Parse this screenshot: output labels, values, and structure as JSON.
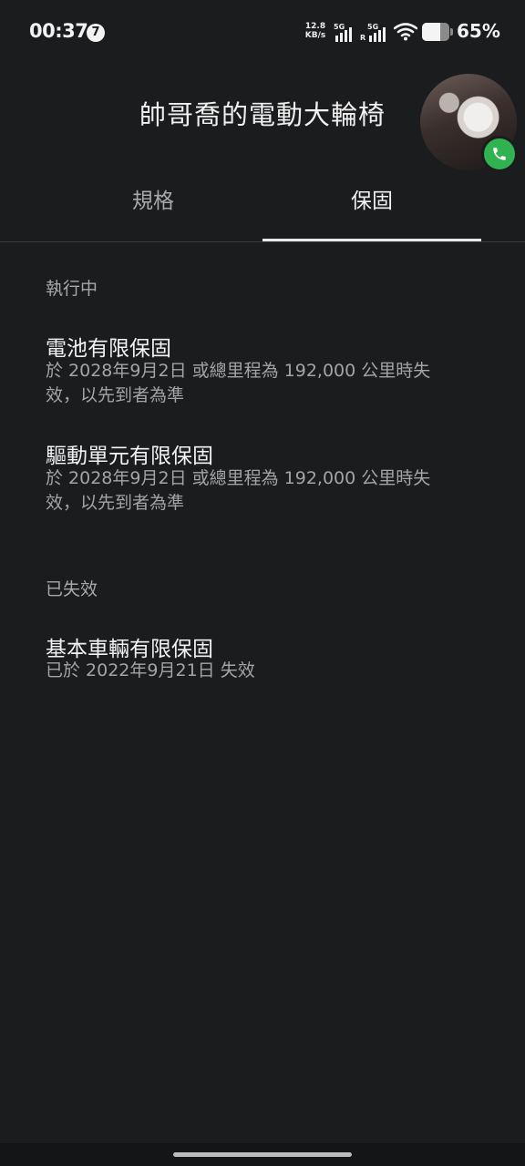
{
  "status_bar": {
    "time": "00:37",
    "notification_count": "7",
    "net_speed_value": "12.8",
    "net_speed_unit": "KB/s",
    "sim1_label": "5G",
    "sim2_label": "5G",
    "sim2_roaming": "R",
    "battery_percent": "65%",
    "battery_level": 0.65
  },
  "header": {
    "title": "帥哥喬的電動大輪椅"
  },
  "tabs": [
    {
      "label": "規格",
      "selected": false
    },
    {
      "label": "保固",
      "selected": true
    }
  ],
  "sections": {
    "active": {
      "label": "執行中",
      "items": [
        {
          "title": "電池有限保固",
          "desc_line1": "於 2028年9月2日 或總里程為 192,000 公里時失",
          "desc_line2": "效，以先到者為準"
        },
        {
          "title": "驅動單元有限保固",
          "desc_line1": "於 2028年9月2日 或總里程為 192,000 公里時失",
          "desc_line2": "效，以先到者為準"
        }
      ]
    },
    "expired": {
      "label": "已失效",
      "items": [
        {
          "title": "基本車輛有限保固",
          "desc_line1": "已於 2022年9月21日 失效"
        }
      ]
    }
  },
  "colors": {
    "background": "#1b1c1e",
    "call_green": "#2fb24f"
  },
  "icons": [
    "call-icon",
    "wifi-icon",
    "signal-icon",
    "battery-icon"
  ]
}
